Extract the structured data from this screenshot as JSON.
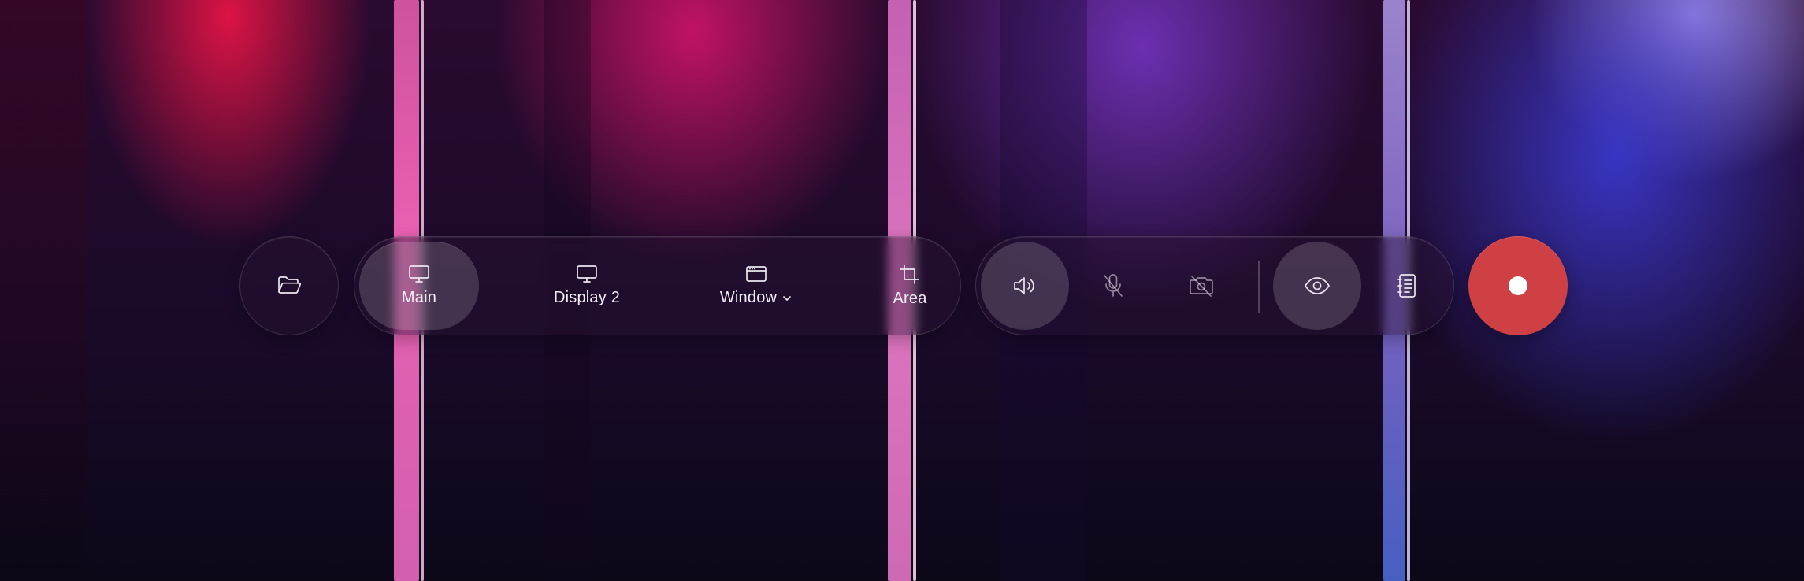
{
  "open_button": {
    "icon": "folder-open-icon"
  },
  "sources": {
    "tabs": [
      {
        "label": "Main",
        "icon": "monitor-icon",
        "active": true
      },
      {
        "label": "Display 2",
        "icon": "monitor-icon",
        "active": false
      },
      {
        "label": "Window",
        "icon": "window-icon",
        "active": false,
        "has_dropdown": true
      },
      {
        "label": "Area",
        "icon": "crop-icon",
        "active": false
      }
    ]
  },
  "inputs": {
    "buttons": [
      {
        "name": "system-audio",
        "icon": "speaker-icon",
        "active": true
      },
      {
        "name": "microphone",
        "icon": "mic-off-icon",
        "active": false
      },
      {
        "name": "camera",
        "icon": "camera-off-icon",
        "active": false
      },
      {
        "name": "preview",
        "icon": "eye-icon",
        "active": true
      },
      {
        "name": "notes",
        "icon": "notebook-icon",
        "active": false
      }
    ]
  },
  "record_button": {
    "icon": "record-dot-icon",
    "color": "#d04146"
  }
}
